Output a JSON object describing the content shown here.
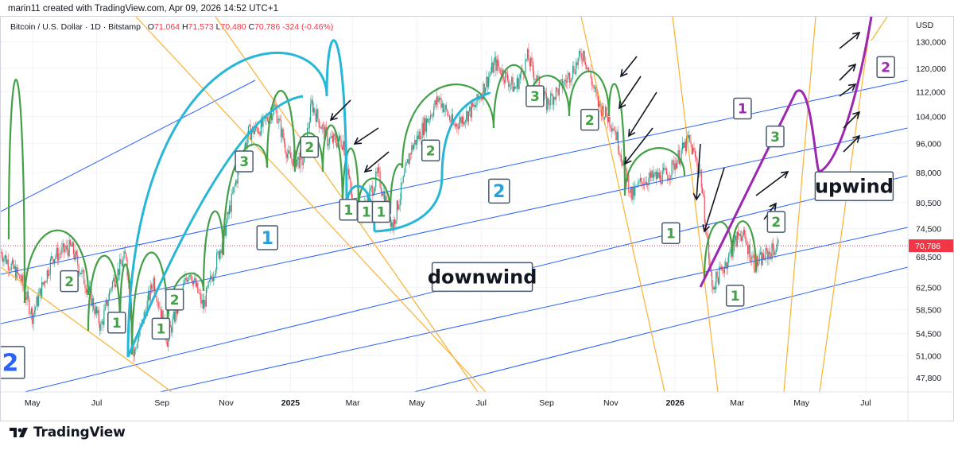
{
  "header": {
    "credit": "marin11 created with TradingView.com, Apr 09, 2026 14:52 UTC+1"
  },
  "legend": {
    "symbol": "Bitcoin / U.S. Dollar · 1D · Bitstamp",
    "open_label": "O",
    "open": "71,064",
    "high_label": "H",
    "high": "71,573",
    "low_label": "L",
    "low": "70,480",
    "close_label": "C",
    "close": "70,786",
    "change": "-324 (-0.46%)"
  },
  "footer": {
    "brand": "TradingView"
  },
  "chart_data": {
    "type": "candlestick",
    "symbol": "Bitcoin / U.S. Dollar",
    "interval": "1D",
    "exchange": "Bitstamp",
    "currency": "USD",
    "y_scale": "log",
    "y_ticks": [
      47800,
      51000,
      54500,
      58500,
      62500,
      68500,
      74500,
      80500,
      88000,
      96000,
      104000,
      112000,
      120000,
      130000
    ],
    "y_tick_labels": [
      "47,800",
      "51,000",
      "54,500",
      "58,500",
      "62,500",
      "68,500",
      "74,500",
      "80,500",
      "88,000",
      "96,000",
      "104,000",
      "112,000",
      "120,000",
      "130,000"
    ],
    "y_range": [
      45800,
      140000
    ],
    "last_price": 70786,
    "last_price_label": "70,786",
    "last_price_color": "#f23645",
    "x_ticks": [
      {
        "label": "May",
        "date": "2024-05-01",
        "bold": false
      },
      {
        "label": "Jul",
        "date": "2024-07-01",
        "bold": false
      },
      {
        "label": "Sep",
        "date": "2024-09-01",
        "bold": false
      },
      {
        "label": "Nov",
        "date": "2024-11-01",
        "bold": false
      },
      {
        "label": "2025",
        "date": "2025-01-01",
        "bold": true
      },
      {
        "label": "Mar",
        "date": "2025-03-01",
        "bold": false
      },
      {
        "label": "May",
        "date": "2025-05-01",
        "bold": false
      },
      {
        "label": "Jul",
        "date": "2025-07-01",
        "bold": false
      },
      {
        "label": "Sep",
        "date": "2025-09-01",
        "bold": false
      },
      {
        "label": "Nov",
        "date": "2025-11-01",
        "bold": false
      },
      {
        "label": "2026",
        "date": "2026-01-01",
        "bold": true
      },
      {
        "label": "Mar",
        "date": "2026-03-01",
        "bold": false
      },
      {
        "label": "May",
        "date": "2026-05-01",
        "bold": false
      },
      {
        "label": "Jul",
        "date": "2026-07-01",
        "bold": false
      }
    ],
    "x_range": [
      "2024-04-01",
      "2026-08-10"
    ],
    "price_path": [
      [
        "2024-04-01",
        69500
      ],
      [
        "2024-04-20",
        64000
      ],
      [
        "2024-05-01",
        57500
      ],
      [
        "2024-05-20",
        68500
      ],
      [
        "2024-06-07",
        70500
      ],
      [
        "2024-06-25",
        61000
      ],
      [
        "2024-07-05",
        55500
      ],
      [
        "2024-07-15",
        63000
      ],
      [
        "2024-07-29",
        69000
      ],
      [
        "2024-08-05",
        51000
      ],
      [
        "2024-08-24",
        64000
      ],
      [
        "2024-09-06",
        53500
      ],
      [
        "2024-09-27",
        66000
      ],
      [
        "2024-10-10",
        59000
      ],
      [
        "2024-10-29",
        72500
      ],
      [
        "2024-11-12",
        88000
      ],
      [
        "2024-11-22",
        99000
      ],
      [
        "2024-12-05",
        101000
      ],
      [
        "2024-12-17",
        107000
      ],
      [
        "2024-12-30",
        92000
      ],
      [
        "2025-01-13",
        91000
      ],
      [
        "2025-01-21",
        108000
      ],
      [
        "2025-02-05",
        97000
      ],
      [
        "2025-02-20",
        96500
      ],
      [
        "2025-03-01",
        80000
      ],
      [
        "2025-03-10",
        78000
      ],
      [
        "2025-03-25",
        87500
      ],
      [
        "2025-04-08",
        75000
      ],
      [
        "2025-04-25",
        94000
      ],
      [
        "2025-05-22",
        110000
      ],
      [
        "2025-06-05",
        101000
      ],
      [
        "2025-06-25",
        107000
      ],
      [
        "2025-07-14",
        122000
      ],
      [
        "2025-08-02",
        113000
      ],
      [
        "2025-08-14",
        124000
      ],
      [
        "2025-09-01",
        108000
      ],
      [
        "2025-09-20",
        116000
      ],
      [
        "2025-10-06",
        126000
      ],
      [
        "2025-10-20",
        108000
      ],
      [
        "2025-11-04",
        101000
      ],
      [
        "2025-11-21",
        82000
      ],
      [
        "2025-12-01",
        86000
      ],
      [
        "2025-12-25",
        87500
      ],
      [
        "2026-01-14",
        97000
      ],
      [
        "2026-01-25",
        88000
      ],
      [
        "2026-02-05",
        62500
      ],
      [
        "2026-02-20",
        68000
      ],
      [
        "2026-03-04",
        74000
      ],
      [
        "2026-03-18",
        67000
      ],
      [
        "2026-04-09",
        70786
      ]
    ],
    "annotations": {
      "numbers": [
        {
          "text": "2",
          "date": "2024-04-10",
          "price": 50000,
          "color": "#2962ff",
          "size": "xl"
        },
        {
          "text": "2",
          "date": "2024-06-05",
          "price": 63700,
          "color": "#43a047",
          "size": "m"
        },
        {
          "text": "1",
          "date": "2024-07-20",
          "price": 56300,
          "color": "#43a047",
          "size": "m"
        },
        {
          "text": "1",
          "date": "2024-08-31",
          "price": 55300,
          "color": "#43a047",
          "size": "m"
        },
        {
          "text": "2",
          "date": "2024-09-13",
          "price": 60300,
          "color": "#43a047",
          "size": "m"
        },
        {
          "text": "3",
          "date": "2024-11-18",
          "price": 91000,
          "color": "#43a047",
          "size": "m"
        },
        {
          "text": "1",
          "date": "2024-12-10",
          "price": 72500,
          "color": "#26a0da",
          "size": "l"
        },
        {
          "text": "2",
          "date": "2025-01-19",
          "price": 95000,
          "color": "#43a047",
          "size": "m"
        },
        {
          "text": "1",
          "date": "2025-02-25",
          "price": 78800,
          "color": "#43a047",
          "size": "m"
        },
        {
          "text": "1",
          "date": "2025-03-14",
          "price": 78300,
          "color": "#43a047",
          "size": "m"
        },
        {
          "text": "1",
          "date": "2025-03-28",
          "price": 78300,
          "color": "#43a047",
          "size": "m"
        },
        {
          "text": "2",
          "date": "2025-05-14",
          "price": 94000,
          "color": "#43a047",
          "size": "m"
        },
        {
          "text": "2",
          "date": "2025-07-18",
          "price": 83300,
          "color": "#26a0da",
          "size": "l"
        },
        {
          "text": "3",
          "date": "2025-08-21",
          "price": 110500,
          "color": "#43a047",
          "size": "m"
        },
        {
          "text": "2",
          "date": "2025-10-12",
          "price": 103000,
          "color": "#43a047",
          "size": "m"
        },
        {
          "text": "1",
          "date": "2025-12-28",
          "price": 73500,
          "color": "#43a047",
          "size": "m"
        },
        {
          "text": "1",
          "date": "2026-02-27",
          "price": 61000,
          "color": "#43a047",
          "size": "m"
        },
        {
          "text": "2",
          "date": "2026-04-07",
          "price": 76000,
          "color": "#43a047",
          "size": "m"
        },
        {
          "text": "3",
          "date": "2026-04-06",
          "price": 98000,
          "color": "#43a047",
          "size": "m"
        },
        {
          "text": "1",
          "date": "2026-03-06",
          "price": 106500,
          "color": "#9c27b0",
          "size": "m"
        },
        {
          "text": "2",
          "date": "2026-07-20",
          "price": 120500,
          "color": "#9c27b0",
          "size": "m"
        }
      ],
      "words": [
        {
          "text": "downwind",
          "date": "2025-07-02",
          "price": 64500
        },
        {
          "text": "upwind",
          "date": "2026-06-20",
          "price": 84500
        }
      ]
    },
    "grid": true,
    "legend_position": "top-left"
  }
}
